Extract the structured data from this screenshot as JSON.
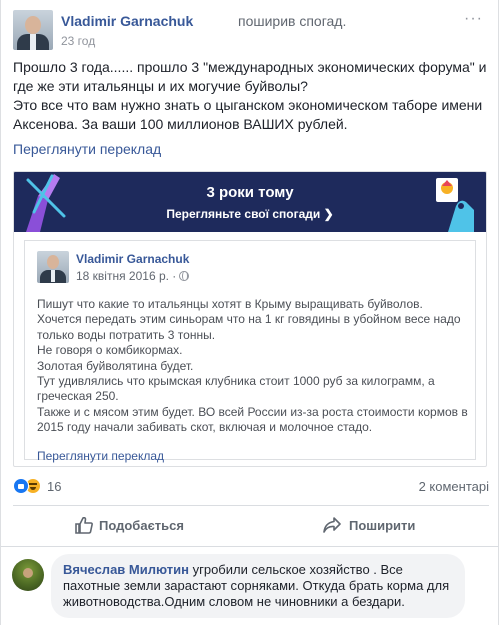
{
  "post": {
    "author": "Vladimir Garnachuk",
    "action": "поширив спогад.",
    "time": "23 год",
    "more": "···",
    "message": [
      "Прошло 3 года...... прошло 3 \"международных экономических форума\" и",
      "где же эти итальянцы и их могучие буйволы?",
      "Это все что вам нужно знать о цыганском экономическом таборе имени",
      "Аксенова. За ваши 100 миллионов ВАШИХ рублей."
    ],
    "see_translation": "Переглянути переклад"
  },
  "memory": {
    "banner_title": "3 роки тому",
    "banner_subtitle": "Перегляньте свої спогади ❯",
    "author": "Vladimir Garnachuk",
    "date": "18 квітня 2016 р. ·",
    "text": [
      "Пишут что какие то итальянцы хотят в Крыму выращивать буйволов.",
      "Хочется передать этим синьорам что на 1 кг говядины в убойном весе надо",
      "только воды потратить 3 тонны.",
      "Не говоря о комбикормах.",
      "Золотая буйволятина будет.",
      "Тут удивлялись что крымская клубника стоит 1000 руб за килограмм, а",
      "греческая 250.",
      "Также и с мясом этим будет. ВО всей России из-за роста стоимости кормов в",
      "2015 году начали забивать скот, включая и молочное стадо."
    ],
    "see_translation": "Переглянути переклад"
  },
  "stats": {
    "reactions_count": "16",
    "comments": "2 коментарі"
  },
  "actions": {
    "like": "Подобається",
    "share": "Поширити"
  },
  "comment": {
    "author": "Вячеслав Милютин",
    "text_lines": [
      " угробили сельское хозяйство . Все",
      "пахотные земли зарастают сорняками. Откуда брать корма для",
      "животноводства.Одним словом не чиновники а бездари."
    ]
  },
  "colors": {
    "link": "#385898",
    "banner_bg": "#1e2a5c",
    "like_blue": "#1877f2",
    "haha_yellow": "#f7b125"
  }
}
